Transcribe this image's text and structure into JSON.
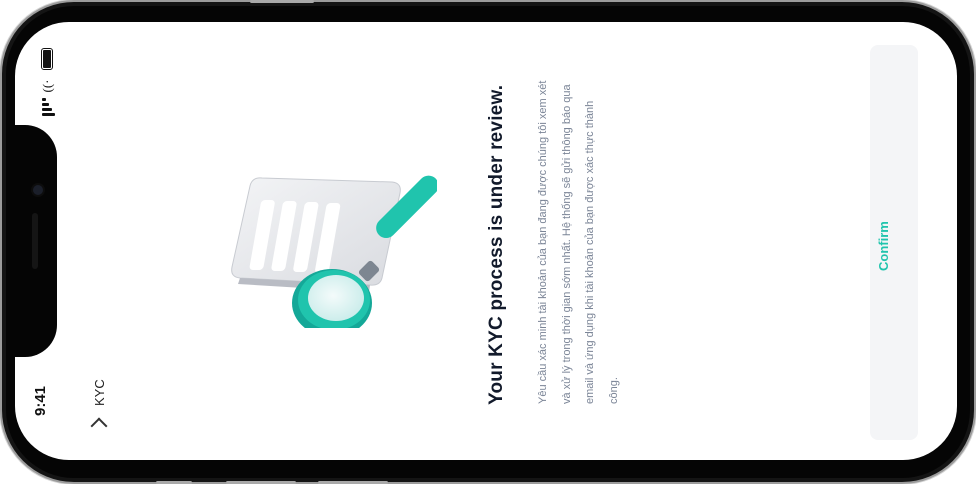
{
  "status_bar": {
    "time": "9:41",
    "icons": [
      "battery-icon",
      "wifi-icon",
      "signal-icon"
    ]
  },
  "nav": {
    "back_icon": "chevron-left-icon",
    "title": "KYC"
  },
  "main": {
    "illustration": "document-magnifier-illustration",
    "heading": "Your KYC process is under review.",
    "description": "Yêu cầu xác minh tài khoản của bạn đang được chúng tôi xem xét và xử lý trong thời gian sớm nhất. Hệ thống sẽ gửi thông báo qua email và ứng dụng khi tài khoản của bạn được xác thực thành công."
  },
  "footer": {
    "confirm_label": "Confirm"
  },
  "colors": {
    "accent": "#20c4ad",
    "heading": "#121a2b",
    "body_text": "#7b8597",
    "button_bg": "#f4f5f7"
  }
}
